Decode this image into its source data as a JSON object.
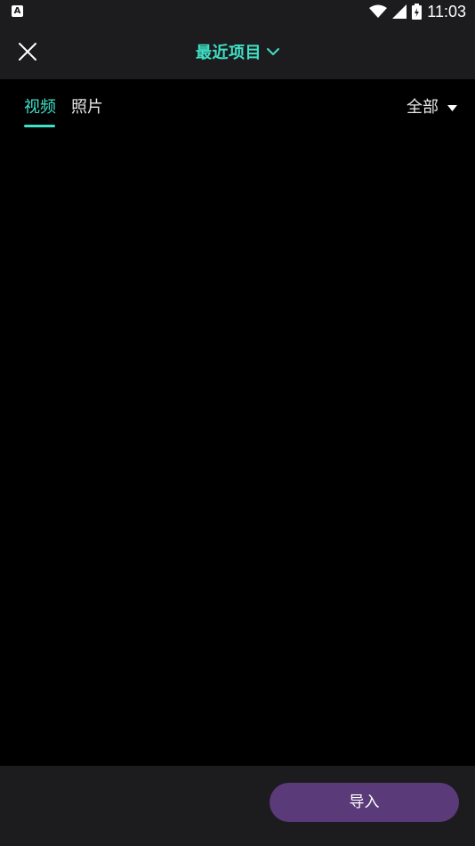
{
  "status_bar": {
    "time": "11:03",
    "left_icon": "A",
    "icons": [
      "wifi-icon",
      "signal-icon",
      "battery-icon"
    ]
  },
  "header": {
    "title": "最近项目",
    "close_icon": "close-icon",
    "dropdown_icon": "chevron-down-icon"
  },
  "tabs": [
    {
      "label": "视频",
      "active": true
    },
    {
      "label": "照片",
      "active": false
    }
  ],
  "filter": {
    "label": "全部",
    "icon": "caret-down-icon"
  },
  "footer": {
    "import_label": "导入"
  },
  "colors": {
    "accent": "#3fe0c6",
    "button_bg": "#5a3a78",
    "bar_bg": "#1c1c1e",
    "content_bg": "#000000"
  }
}
